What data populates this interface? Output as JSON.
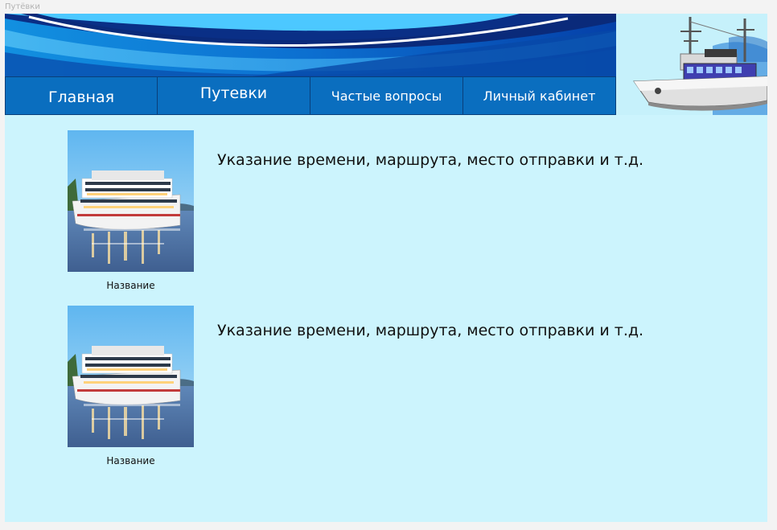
{
  "window": {
    "frame_label": "Путёвки"
  },
  "nav": {
    "items": [
      {
        "label": "Главная"
      },
      {
        "label": "Путевки"
      },
      {
        "label": "Частые вопросы"
      },
      {
        "label": "Личный кабинет"
      }
    ]
  },
  "tours": [
    {
      "caption": "Название",
      "description": "Указание времени, маршрута, место отправки и т.д."
    },
    {
      "caption": "Название",
      "description": "Указание времени, маршрута, место отправки и т.д."
    }
  ],
  "colors": {
    "background": "#ccf4fd",
    "nav": "#0a6ebf",
    "banner": "#0a59b8"
  }
}
